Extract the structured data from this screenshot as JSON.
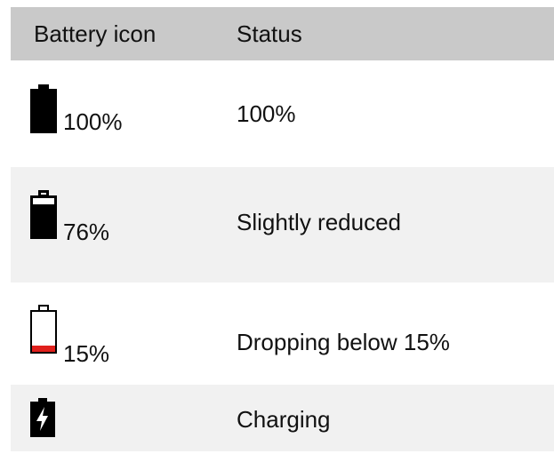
{
  "table": {
    "headers": {
      "battery_icon": "Battery icon",
      "status": "Status"
    },
    "rows": [
      {
        "icon": "battery-full-icon",
        "level_percent": 100,
        "percent_label": "100%",
        "status": "100%"
      },
      {
        "icon": "battery-partial-icon",
        "level_percent": 76,
        "percent_label": "76%",
        "status": "Slightly reduced"
      },
      {
        "icon": "battery-low-icon",
        "level_percent": 15,
        "percent_label": "15%",
        "status": "Dropping below 15%",
        "fill_color": "#e0201c"
      },
      {
        "icon": "battery-charging-icon",
        "percent_label": "",
        "status": "Charging"
      }
    ]
  }
}
